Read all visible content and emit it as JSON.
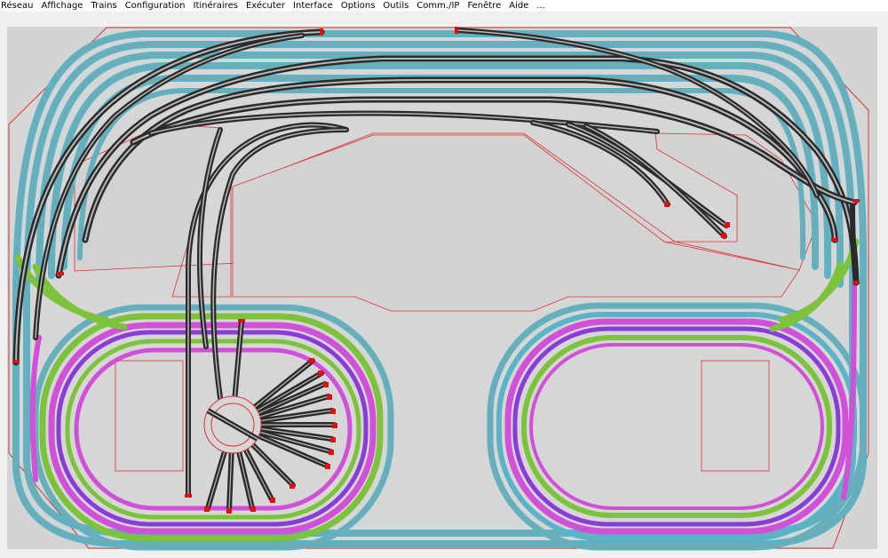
{
  "window": {
    "menu": [
      {
        "id": "reseau",
        "label": "Réseau"
      },
      {
        "id": "affichage",
        "label": "Affichage"
      },
      {
        "id": "trains",
        "label": "Trains"
      },
      {
        "id": "configuration",
        "label": "Configuration"
      },
      {
        "id": "itineraires",
        "label": "Itinéraires"
      },
      {
        "id": "executer",
        "label": "Exécuter"
      },
      {
        "id": "interface",
        "label": "Interface"
      },
      {
        "id": "options",
        "label": "Options"
      },
      {
        "id": "outils",
        "label": "Outils"
      },
      {
        "id": "comm",
        "label": "Comm./IP"
      },
      {
        "id": "fenetre",
        "label": "Fenêtre"
      },
      {
        "id": "aide",
        "label": "Aide"
      },
      {
        "id": "more",
        "label": "..."
      }
    ]
  },
  "colors": {
    "board_bg": "#d4d4d4",
    "board_outline": "#e03030",
    "track_teal": "#5ab4c8",
    "track_teal_core": "#6fa6a6",
    "track_green": "#7cc23a",
    "track_magenta": "#d050d8",
    "track_purple": "#8a3cd8",
    "track_black": "#2a2a2a",
    "track_gray": "#b8b8b8",
    "buffer_red": "#e01010"
  }
}
